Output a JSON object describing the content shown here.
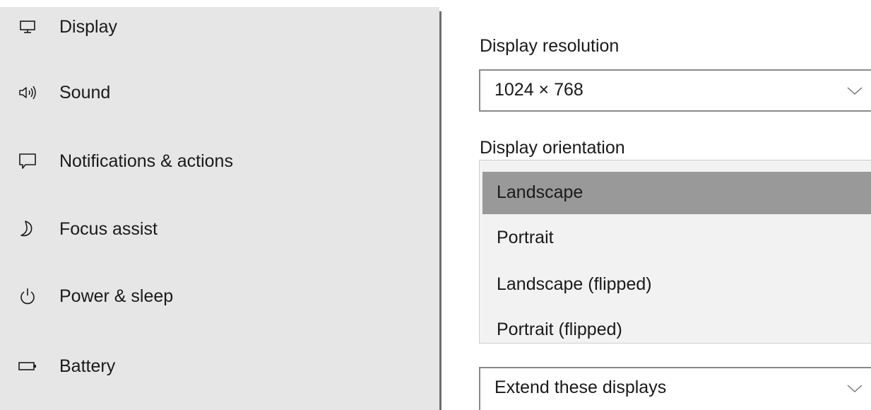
{
  "sidebar": {
    "items": [
      {
        "label": "Display",
        "icon": "monitor-icon"
      },
      {
        "label": "Sound",
        "icon": "speaker-icon"
      },
      {
        "label": "Notifications & actions",
        "icon": "message-icon"
      },
      {
        "label": "Focus assist",
        "icon": "moon-icon"
      },
      {
        "label": "Power & sleep",
        "icon": "power-icon"
      },
      {
        "label": "Battery",
        "icon": "battery-icon"
      }
    ]
  },
  "main": {
    "resolution": {
      "label": "Display resolution",
      "value": "1024 × 768"
    },
    "orientation": {
      "label": "Display orientation",
      "options": [
        "Landscape",
        "Portrait",
        "Landscape (flipped)",
        "Portrait (flipped)"
      ],
      "selected": "Landscape"
    },
    "multiple_displays": {
      "value": "Extend these displays"
    }
  },
  "colors": {
    "sidebar_bg": "#e6e6e6",
    "selected_option_bg": "#999999",
    "dropdown_bg": "#f2f2f2",
    "border": "#8a8a8a"
  }
}
